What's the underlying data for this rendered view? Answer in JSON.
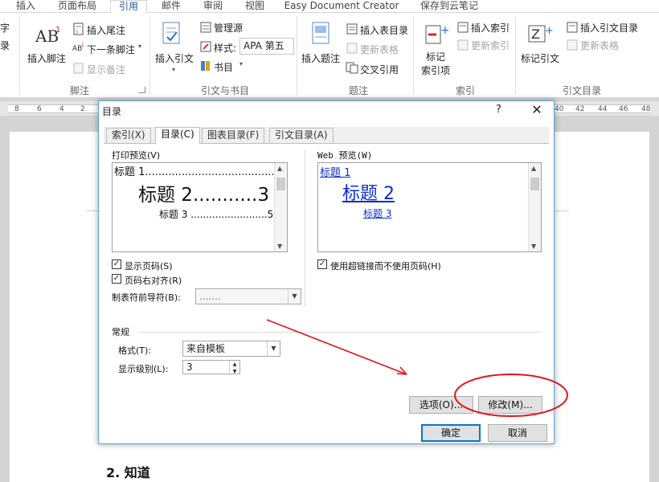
{
  "ribbon": {
    "tabs": [
      "插入",
      "页面布局",
      "引用",
      "邮件",
      "审阅",
      "视图",
      "Easy Document Creator",
      "保存到云笔记"
    ],
    "active_tab": "引用",
    "left_cut": [
      "字",
      "录"
    ],
    "footnote": {
      "insert_footnote": "插入脚注",
      "insert_endnote": "插入尾注",
      "next_footnote": "下一条脚注",
      "show_notes": "显示备注",
      "group": "脚注"
    },
    "citations": {
      "insert_citation": "插入引文",
      "manage_sources": "管理源",
      "style_label": "样式:",
      "style_value": "APA 第五",
      "bibliography": "书目",
      "group": "引文与书目"
    },
    "captions": {
      "insert_caption": "插入题注",
      "insert_table_of_figures": "插入表目录",
      "update_table": "更新表格",
      "cross_reference": "交叉引用",
      "group": "题注"
    },
    "index": {
      "mark_entry_1": "标记",
      "mark_entry_2": "索引项",
      "insert_index": "插入索引",
      "update_index": "更新索引",
      "group": "索引"
    },
    "toa": {
      "mark_citation": "标记引文",
      "insert_toa": "插入引文目录",
      "update_table": "更新表格",
      "group": "引文目录"
    }
  },
  "ruler": {
    "numbers": [
      "8",
      "6",
      "4",
      "2",
      "2",
      "4",
      "6",
      "40",
      "42",
      "44",
      "46",
      "48"
    ]
  },
  "document": {
    "heading": "2.  知道"
  },
  "dialog": {
    "title": "目录",
    "help": "?",
    "close": "✕",
    "tabs": [
      "索引(X)",
      "目录(C)",
      "图表目录(F)",
      "引文目录(A)"
    ],
    "active_tab": "目录(C)",
    "print_preview_label": "打印预览(V)",
    "print_preview": [
      {
        "text": "标题  1.........................................1"
      },
      {
        "text": "标题  2...........3"
      },
      {
        "text": "标题  3 .........................5"
      }
    ],
    "web_preview_label": "Web 预览(W)",
    "web_preview": [
      "标题 1",
      "标题 2",
      "标题 3"
    ],
    "show_page_numbers": "显示页码(S)",
    "right_align": "页码右对齐(R)",
    "tab_leader_label": "制表符前导符(B):",
    "tab_leader_value": ".......",
    "use_hyperlinks": "使用超链接而不使用页码(H)",
    "general_label": "常规",
    "formats_label": "格式(T):",
    "formats_value": "来自模板",
    "levels_label": "显示级别(L):",
    "levels_value": "3",
    "options_button": "选项(O)...",
    "modify_button": "修改(M)...",
    "ok_button": "确定",
    "cancel_button": "取消"
  },
  "colors": {
    "accent": "#2b579a",
    "annotation": "#e0161d",
    "link": "#0b2bd6",
    "dialog_border": "#5aa3d6"
  }
}
